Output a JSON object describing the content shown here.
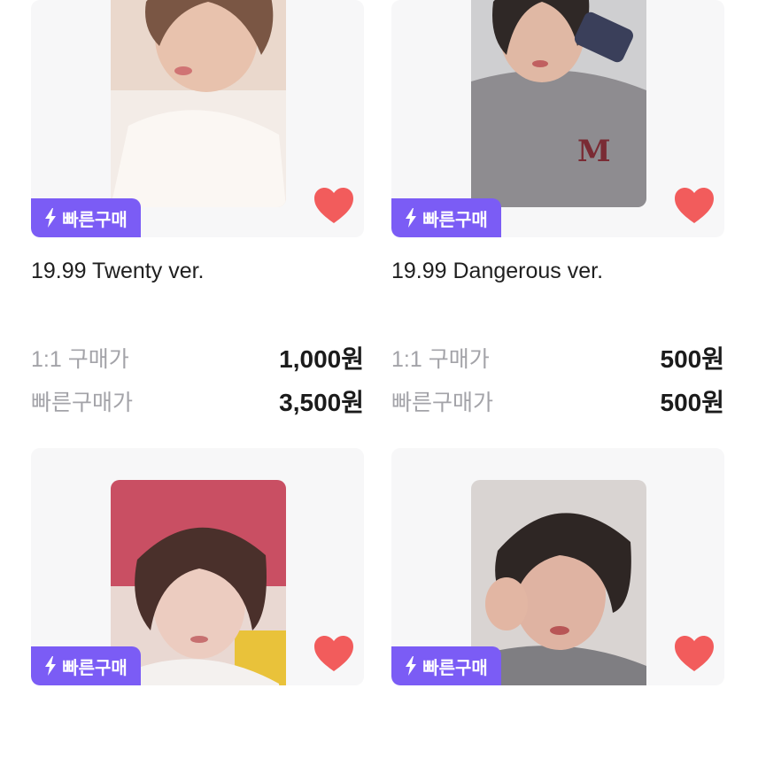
{
  "products": [
    {
      "title": "19.99 Twenty ver.",
      "badge": "빠른구매",
      "prices": [
        {
          "label": "1:1 구매가",
          "value": "1,000원"
        },
        {
          "label": "빠른구매가",
          "value": "3,500원"
        }
      ]
    },
    {
      "title": "19.99 Dangerous ver.",
      "badge": "빠른구매",
      "prices": [
        {
          "label": "1:1 구매가",
          "value": "500원"
        },
        {
          "label": "빠른구매가",
          "value": "500원"
        }
      ]
    },
    {
      "title": "",
      "badge": "빠른구매",
      "prices": []
    },
    {
      "title": "",
      "badge": "빠른구매",
      "prices": []
    }
  ],
  "colors": {
    "badge": "#7b5cf5",
    "heart": "#f25c5c",
    "card_bg": "#f7f7f8"
  },
  "icons": [
    "lightning-icon",
    "heart-icon"
  ]
}
